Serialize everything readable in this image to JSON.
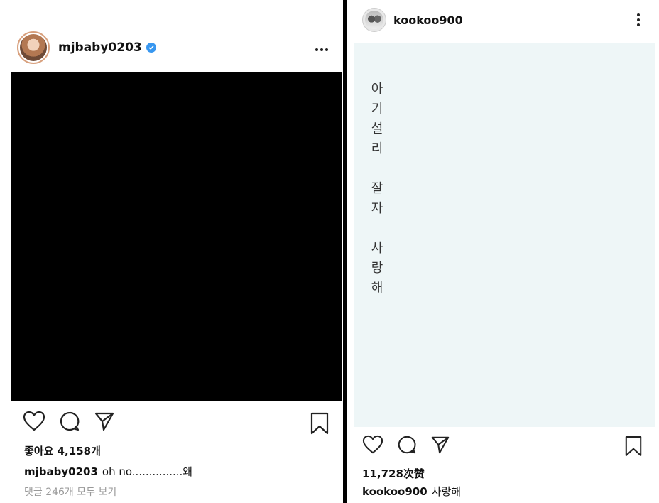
{
  "left_post": {
    "username": "mjbaby0203",
    "verified": true,
    "likes": "좋아요 4,158개",
    "caption_user": "mjbaby0203",
    "caption_text": "oh no...............왜",
    "comments": "댓글 246개 모두 보기",
    "icons": [
      "heart-icon",
      "comment-icon",
      "share-icon",
      "bookmark-icon",
      "more-options-icon",
      "verified-badge-icon"
    ]
  },
  "right_post": {
    "username": "kookoo900",
    "image_text": {
      "line1": [
        "아",
        "기",
        "설",
        "리"
      ],
      "line2": [
        "잘",
        "자"
      ],
      "line3": [
        "사",
        "랑",
        "해"
      ]
    },
    "likes": "11,728次赞",
    "caption_user": "kookoo900",
    "caption_text": "사랑해",
    "icons": [
      "heart-icon",
      "comment-icon",
      "share-icon",
      "bookmark-icon",
      "more-options-icon"
    ]
  },
  "colors": {
    "verified": "#3897f0",
    "right_image_bg": "#eef6f7",
    "divider": "#000000"
  }
}
